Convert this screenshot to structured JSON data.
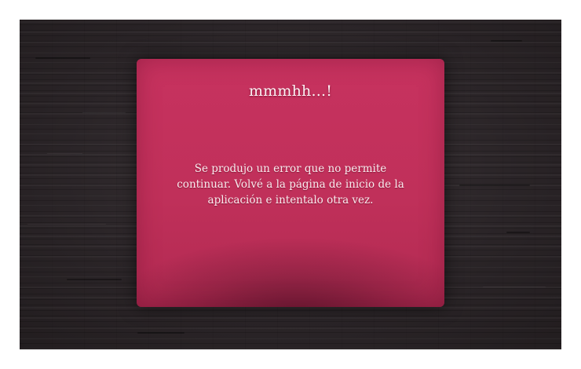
{
  "error_card": {
    "title": "mmmhh...!",
    "message": "Se produjo un error que no permite continuar. Volvé a la página de inicio de la aplicación e intentalo otra vez."
  },
  "colors": {
    "background": "#2c2629",
    "card": "#c0305a",
    "text": "#fdf2f5"
  }
}
